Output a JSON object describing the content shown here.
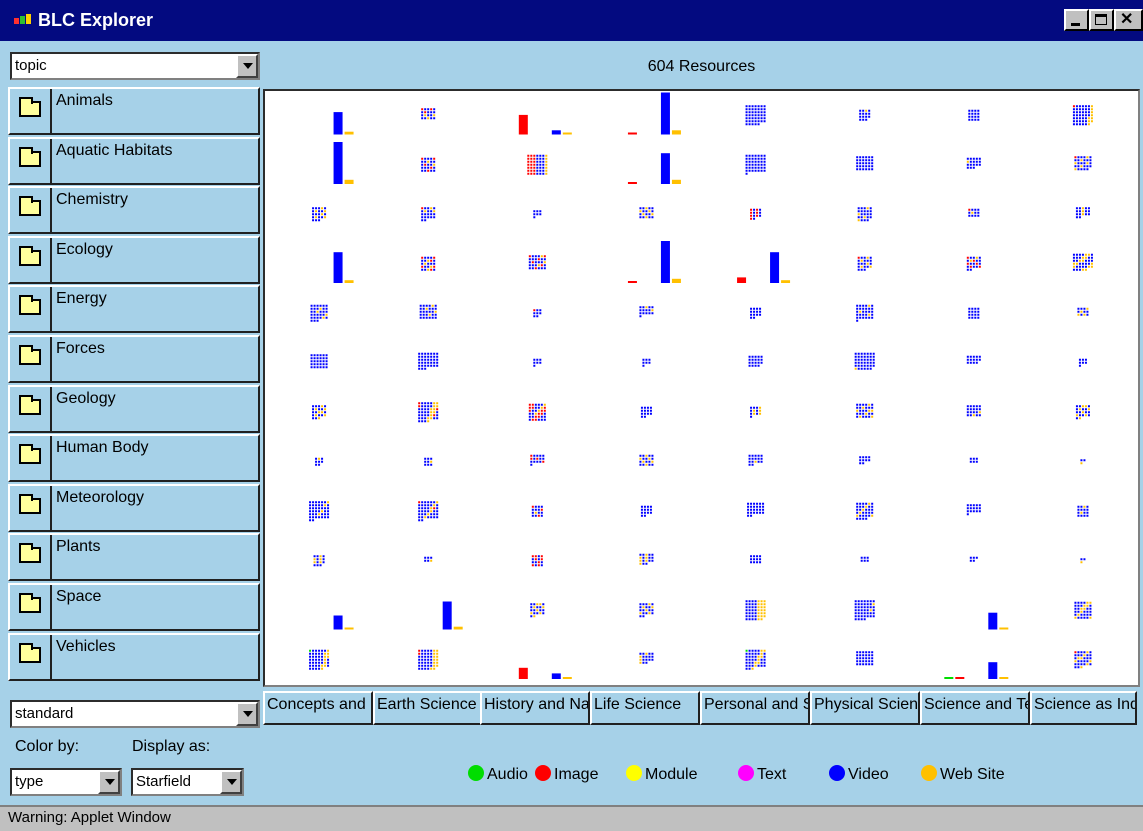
{
  "window": {
    "title": "BLC Explorer"
  },
  "topic_select": {
    "value": "topic"
  },
  "resource_count": "604 Resources",
  "topics": [
    "Animals",
    "Aquatic Habitats",
    "Chemistry",
    "Ecology",
    "Energy",
    "Forces",
    "Geology",
    "Human Body",
    "Meteorology",
    "Plants",
    "Space",
    "Vehicles"
  ],
  "columns": [
    "Concepts and Processes",
    "Earth Science",
    "History and Nature of Science",
    "Life Science",
    "Personal and Social Perspectives",
    "Physical Science",
    "Science and Technology",
    "Science as Inquiry"
  ],
  "standard_select": {
    "value": "standard"
  },
  "color_by": {
    "label": "Color by:",
    "value": "type"
  },
  "display_as": {
    "label": "Display as:",
    "value": "Starfield"
  },
  "legend": [
    {
      "label": "Audio",
      "color": "#00dd00"
    },
    {
      "label": "Image",
      "color": "#ff0000"
    },
    {
      "label": "Module",
      "color": "#ffff00"
    },
    {
      "label": "Text",
      "color": "#ff00ff"
    },
    {
      "label": "Video",
      "color": "#0000ff"
    },
    {
      "label": "Web Site",
      "color": "#ffc000"
    }
  ],
  "status": "Warning: Applet Window",
  "colors": {
    "audio": "#00dd00",
    "image": "#ff0000",
    "module": "#ffff00",
    "text": "#ff00ff",
    "video": "#0000ff",
    "web_site": "#ffc000",
    "panel": "#a6d1e8",
    "titlebar": "#030a80"
  },
  "cells": [
    [
      {
        "m": "bars",
        "b": [
          0,
          0,
          0,
          0,
          16,
          2
        ]
      },
      {
        "m": "dots",
        "s": 5,
        "t": [
          0,
          3,
          0,
          0,
          14,
          3
        ]
      },
      {
        "m": "bars",
        "b": [
          0,
          14,
          0,
          0,
          3,
          1
        ]
      },
      {
        "m": "bars",
        "b": [
          0,
          1,
          0,
          0,
          30,
          3
        ]
      },
      {
        "m": "dots",
        "s": 7,
        "t": [
          0,
          0,
          0,
          0,
          47,
          0
        ]
      },
      {
        "m": "dots",
        "s": 4,
        "t": [
          0,
          0,
          0,
          0,
          14,
          1
        ]
      },
      {
        "m": "dots",
        "s": 4,
        "t": [
          0,
          0,
          0,
          0,
          16,
          0
        ]
      },
      {
        "m": "dots",
        "s": 7,
        "t": [
          0,
          1,
          0,
          0,
          38,
          9
        ]
      }
    ],
    [
      {
        "m": "bars",
        "b": [
          0,
          0,
          0,
          0,
          30,
          3
        ]
      },
      {
        "m": "dots",
        "s": 5,
        "t": [
          0,
          5,
          0,
          0,
          18,
          2
        ]
      },
      {
        "m": "dots",
        "s": 7,
        "t": [
          0,
          16,
          0,
          0,
          23,
          10
        ]
      },
      {
        "m": "bars",
        "b": [
          0,
          1,
          0,
          0,
          22,
          3
        ]
      },
      {
        "m": "dots",
        "s": 7,
        "t": [
          0,
          0,
          0,
          0,
          43,
          0
        ]
      },
      {
        "m": "dots",
        "s": 6,
        "t": [
          0,
          0,
          0,
          0,
          30,
          0
        ]
      },
      {
        "m": "dots",
        "s": 5,
        "t": [
          0,
          0,
          0,
          0,
          17,
          1
        ]
      },
      {
        "m": "dots",
        "s": 6,
        "t": [
          0,
          1,
          0,
          0,
          22,
          6
        ]
      }
    ],
    [
      {
        "m": "dots",
        "s": 5,
        "t": [
          0,
          0,
          0,
          0,
          17,
          6
        ]
      },
      {
        "m": "dots",
        "s": 5,
        "t": [
          0,
          1,
          0,
          0,
          18,
          3
        ]
      },
      {
        "m": "dots",
        "s": 3,
        "t": [
          0,
          0,
          0,
          0,
          6,
          1
        ]
      },
      {
        "m": "dots",
        "s": 5,
        "t": [
          0,
          0,
          0,
          0,
          14,
          6
        ]
      },
      {
        "m": "dots",
        "s": 4,
        "t": [
          0,
          1,
          0,
          0,
          12,
          1
        ]
      },
      {
        "m": "dots",
        "s": 5,
        "t": [
          0,
          0,
          0,
          0,
          20,
          4
        ]
      },
      {
        "m": "dots",
        "s": 4,
        "t": [
          0,
          1,
          0,
          0,
          10,
          1
        ]
      },
      {
        "m": "dots",
        "s": 5,
        "t": [
          0,
          0,
          0,
          0,
          14,
          3
        ]
      }
    ],
    [
      {
        "m": "bars",
        "b": [
          0,
          0,
          0,
          0,
          22,
          2
        ]
      },
      {
        "m": "dots",
        "s": 5,
        "t": [
          0,
          6,
          0,
          0,
          16,
          4
        ]
      },
      {
        "m": "dots",
        "s": 6,
        "t": [
          0,
          6,
          0,
          0,
          21,
          3
        ]
      },
      {
        "m": "bars",
        "b": [
          0,
          1,
          0,
          0,
          30,
          3
        ]
      },
      {
        "m": "bars",
        "b": [
          0,
          4,
          0,
          0,
          22,
          2
        ]
      },
      {
        "m": "dots",
        "s": 5,
        "t": [
          0,
          1,
          0,
          0,
          17,
          5
        ]
      },
      {
        "m": "dots",
        "s": 5,
        "t": [
          0,
          6,
          0,
          0,
          14,
          2
        ]
      },
      {
        "m": "dots",
        "s": 7,
        "t": [
          0,
          0,
          0,
          0,
          26,
          14
        ]
      }
    ],
    [
      {
        "m": "dots",
        "s": 6,
        "t": [
          0,
          0,
          0,
          0,
          29,
          4
        ]
      },
      {
        "m": "dots",
        "s": 6,
        "t": [
          0,
          0,
          0,
          0,
          26,
          4
        ]
      },
      {
        "m": "dots",
        "s": 3,
        "t": [
          0,
          1,
          0,
          0,
          7,
          0
        ]
      },
      {
        "m": "dots",
        "s": 5,
        "t": [
          0,
          0,
          0,
          0,
          14,
          2
        ]
      },
      {
        "m": "dots",
        "s": 4,
        "t": [
          0,
          0,
          0,
          0,
          12,
          2
        ]
      },
      {
        "m": "dots",
        "s": 6,
        "t": [
          0,
          0,
          0,
          0,
          28,
          3
        ]
      },
      {
        "m": "dots",
        "s": 4,
        "t": [
          0,
          0,
          0,
          0,
          16,
          0
        ]
      },
      {
        "m": "dots",
        "s": 4,
        "t": [
          0,
          0,
          0,
          0,
          8,
          4
        ]
      }
    ],
    [
      {
        "m": "dots",
        "s": 6,
        "t": [
          0,
          0,
          0,
          0,
          30,
          0
        ]
      },
      {
        "m": "dots",
        "s": 7,
        "t": [
          0,
          0,
          0,
          0,
          38,
          0
        ]
      },
      {
        "m": "dots",
        "s": 3,
        "t": [
          0,
          0,
          0,
          0,
          7,
          0
        ]
      },
      {
        "m": "dots",
        "s": 3,
        "t": [
          0,
          0,
          0,
          0,
          7,
          0
        ]
      },
      {
        "m": "dots",
        "s": 5,
        "t": [
          0,
          0,
          0,
          0,
          19,
          0
        ]
      },
      {
        "m": "dots",
        "s": 7,
        "t": [
          0,
          0,
          0,
          0,
          40,
          1
        ]
      },
      {
        "m": "dots",
        "s": 5,
        "t": [
          0,
          0,
          0,
          0,
          13,
          1
        ]
      },
      {
        "m": "dots",
        "s": 3,
        "t": [
          0,
          0,
          0,
          0,
          5,
          2
        ]
      }
    ],
    [
      {
        "m": "dots",
        "s": 5,
        "t": [
          0,
          0,
          0,
          0,
          15,
          8
        ]
      },
      {
        "m": "dots",
        "s": 7,
        "t": [
          0,
          4,
          0,
          0,
          30,
          12
        ]
      },
      {
        "m": "dots",
        "s": 6,
        "t": [
          0,
          14,
          0,
          0,
          18,
          4
        ]
      },
      {
        "m": "dots",
        "s": 4,
        "t": [
          0,
          0,
          0,
          0,
          10,
          4
        ]
      },
      {
        "m": "dots",
        "s": 4,
        "t": [
          0,
          0,
          0,
          0,
          8,
          5
        ]
      },
      {
        "m": "dots",
        "s": 6,
        "t": [
          0,
          0,
          0,
          0,
          22,
          8
        ]
      },
      {
        "m": "dots",
        "s": 5,
        "t": [
          0,
          0,
          0,
          0,
          18,
          2
        ]
      },
      {
        "m": "dots",
        "s": 5,
        "t": [
          0,
          0,
          0,
          0,
          14,
          8
        ]
      }
    ],
    [
      {
        "m": "dots",
        "s": 3,
        "t": [
          0,
          0,
          0,
          0,
          7,
          1
        ]
      },
      {
        "m": "dots",
        "s": 3,
        "t": [
          0,
          0,
          0,
          0,
          8,
          1
        ]
      },
      {
        "m": "dots",
        "s": 5,
        "t": [
          0,
          4,
          0,
          0,
          12,
          0
        ]
      },
      {
        "m": "dots",
        "s": 5,
        "t": [
          0,
          0,
          0,
          0,
          14,
          6
        ]
      },
      {
        "m": "dots",
        "s": 5,
        "t": [
          0,
          0,
          0,
          0,
          16,
          1
        ]
      },
      {
        "m": "dots",
        "s": 4,
        "t": [
          0,
          0,
          0,
          0,
          10,
          0
        ]
      },
      {
        "m": "dots",
        "s": 3,
        "t": [
          0,
          0,
          0,
          0,
          6,
          0
        ]
      },
      {
        "m": "dots",
        "s": 2,
        "t": [
          0,
          0,
          0,
          0,
          2,
          1
        ]
      }
    ],
    [
      {
        "m": "dots",
        "s": 7,
        "t": [
          0,
          0,
          0,
          0,
          40,
          4
        ]
      },
      {
        "m": "dots",
        "s": 7,
        "t": [
          0,
          2,
          0,
          0,
          36,
          6
        ]
      },
      {
        "m": "dots",
        "s": 4,
        "t": [
          0,
          3,
          0,
          0,
          12,
          1
        ]
      },
      {
        "m": "dots",
        "s": 4,
        "t": [
          0,
          0,
          0,
          0,
          14,
          0
        ]
      },
      {
        "m": "dots",
        "s": 6,
        "t": [
          0,
          0,
          0,
          0,
          26,
          0
        ]
      },
      {
        "m": "dots",
        "s": 6,
        "t": [
          0,
          0,
          0,
          0,
          28,
          6
        ]
      },
      {
        "m": "dots",
        "s": 5,
        "t": [
          0,
          0,
          0,
          0,
          16,
          0
        ]
      },
      {
        "m": "dots",
        "s": 4,
        "t": [
          0,
          0,
          0,
          0,
          14,
          2
        ]
      }
    ],
    [
      {
        "m": "dots",
        "s": 4,
        "t": [
          0,
          0,
          0,
          0,
          10,
          5
        ]
      },
      {
        "m": "dots",
        "s": 3,
        "t": [
          0,
          0,
          0,
          0,
          5,
          1
        ]
      },
      {
        "m": "dots",
        "s": 4,
        "t": [
          0,
          8,
          0,
          0,
          8,
          0
        ]
      },
      {
        "m": "dots",
        "s": 5,
        "t": [
          0,
          0,
          0,
          0,
          12,
          6
        ]
      },
      {
        "m": "dots",
        "s": 4,
        "t": [
          0,
          0,
          0,
          0,
          12,
          0
        ]
      },
      {
        "m": "dots",
        "s": 3,
        "t": [
          0,
          0,
          0,
          0,
          6,
          0
        ]
      },
      {
        "m": "dots",
        "s": 3,
        "t": [
          0,
          0,
          0,
          0,
          5,
          0
        ]
      },
      {
        "m": "dots",
        "s": 2,
        "t": [
          0,
          0,
          0,
          0,
          2,
          1
        ]
      }
    ],
    [
      {
        "m": "bars",
        "b": [
          0,
          0,
          0,
          0,
          10,
          1
        ]
      },
      {
        "m": "bars",
        "b": [
          0,
          0,
          0,
          0,
          20,
          2
        ]
      },
      {
        "m": "dots",
        "s": 5,
        "t": [
          0,
          0,
          0,
          0,
          14,
          8
        ]
      },
      {
        "m": "dots",
        "s": 5,
        "t": [
          0,
          0,
          0,
          0,
          16,
          6
        ]
      },
      {
        "m": "dots",
        "s": 7,
        "t": [
          0,
          0,
          0,
          0,
          28,
          20
        ]
      },
      {
        "m": "dots",
        "s": 7,
        "t": [
          0,
          0,
          0,
          0,
          44,
          2
        ]
      },
      {
        "m": "bars",
        "b": [
          0,
          0,
          0,
          0,
          12,
          1
        ]
      },
      {
        "m": "dots",
        "s": 6,
        "t": [
          0,
          0,
          0,
          0,
          26,
          10
        ]
      }
    ],
    [
      {
        "m": "dots",
        "s": 7,
        "t": [
          1,
          0,
          0,
          0,
          36,
          10
        ]
      },
      {
        "m": "dots",
        "s": 7,
        "t": [
          0,
          2,
          0,
          0,
          32,
          14
        ]
      },
      {
        "m": "bars",
        "b": [
          0,
          8,
          0,
          0,
          4,
          1
        ]
      },
      {
        "m": "dots",
        "s": 5,
        "t": [
          0,
          0,
          0,
          0,
          14,
          4
        ]
      },
      {
        "m": "dots",
        "s": 7,
        "t": [
          1,
          0,
          0,
          0,
          34,
          10
        ]
      },
      {
        "m": "dots",
        "s": 6,
        "t": [
          0,
          0,
          0,
          0,
          30,
          0
        ]
      },
      {
        "m": "bars",
        "b": [
          1,
          1,
          0,
          0,
          12,
          1
        ]
      },
      {
        "m": "dots",
        "s": 6,
        "t": [
          0,
          1,
          0,
          0,
          24,
          8
        ]
      }
    ]
  ]
}
